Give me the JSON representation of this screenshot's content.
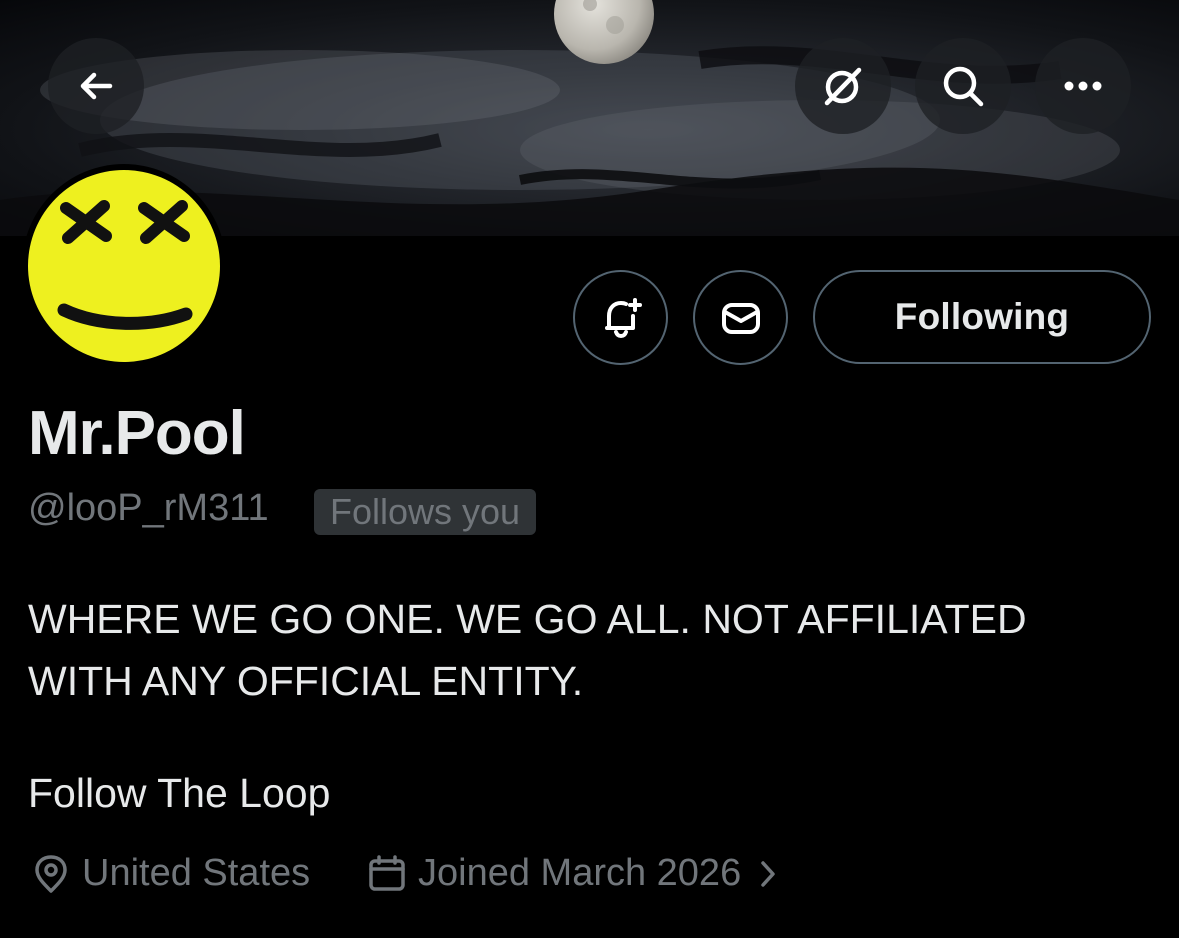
{
  "header": {
    "back_icon": "arrow-left-icon",
    "actions": [
      {
        "icon": "grok-icon"
      },
      {
        "icon": "search-icon"
      },
      {
        "icon": "more-icon"
      }
    ]
  },
  "profile": {
    "display_name": "Mr.Pool",
    "handle": "@looP_rM311",
    "follows_you_badge": "Follows you",
    "bio_lines": [
      "WHERE WE GO ONE. WE GO ALL. NOT AFFILIATED",
      "WITH ANY OFFICIAL ENTITY."
    ],
    "bio_extra": "Follow The Loop",
    "location": "United States",
    "joined": "Joined March 2026"
  },
  "actions": {
    "notifications_icon": "bell-plus-icon",
    "message_icon": "envelope-icon",
    "following_label": "Following"
  },
  "colors": {
    "background": "#000000",
    "text": "#e7e9ea",
    "secondary_text": "#71767b",
    "border": "#536471",
    "badge_bg": "#2f3336",
    "avatar_yellow": "#eef01f"
  }
}
